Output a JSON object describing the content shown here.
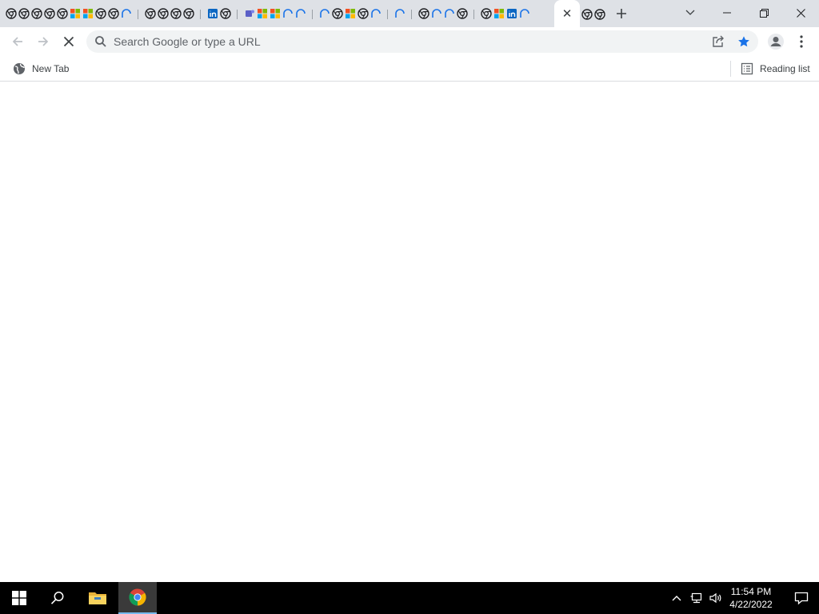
{
  "window": {
    "tab_close_glyph": "✕",
    "new_tab_glyph": "+"
  },
  "tabs": {
    "favicons": [
      "chrome-icon",
      "chrome-icon",
      "chrome-icon",
      "chrome-icon",
      "chrome-icon",
      "microsoft-icon",
      "microsoft-icon",
      "chrome-icon",
      "chrome-icon",
      "loading-icon",
      "gap",
      "chrome-icon",
      "chrome-icon",
      "chrome-icon",
      "chrome-icon",
      "gap",
      "linkedin-icon",
      "chrome-icon",
      "gap",
      "teams-icon",
      "microsoft-icon",
      "microsoft-icon",
      "loading-icon",
      "loading-icon",
      "gap",
      "loading-icon",
      "chrome-icon",
      "microsoft-icon",
      "chrome-icon",
      "loading-icon",
      "gap",
      "loading-icon",
      "gap",
      "chrome-icon",
      "loading-icon",
      "loading-icon",
      "chrome-icon",
      "gap",
      "chrome-icon",
      "microsoft-icon",
      "linkedin-icon",
      "loading-icon"
    ],
    "trailing_favicons": [
      "chrome-icon",
      "chrome-icon"
    ]
  },
  "toolbar": {
    "omnibox_placeholder": "Search Google or type a URL"
  },
  "bookmarks": {
    "items": [
      {
        "label": "New Tab",
        "icon": "globe-icon"
      }
    ],
    "reading_list_label": "Reading list"
  },
  "taskbar": {
    "time": "11:54 PM",
    "date": "4/22/2022"
  },
  "colors": {
    "tabstrip_bg": "#dee1e6",
    "star_blue": "#1a73e8",
    "taskbar_bg": "#000000",
    "omnibox_bg": "#f1f3f4"
  }
}
